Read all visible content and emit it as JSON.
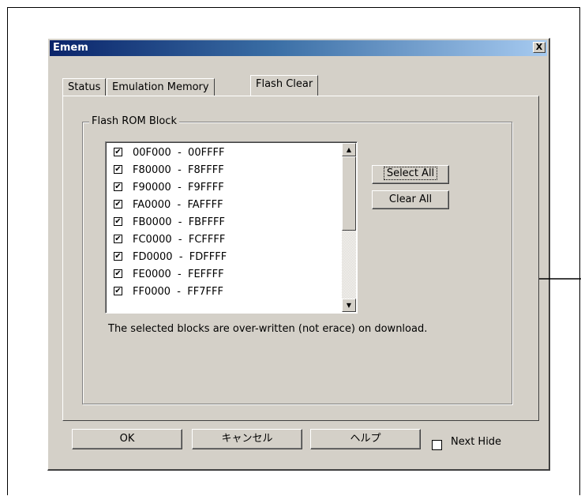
{
  "dialog": {
    "title": "Emem",
    "close_label": "X"
  },
  "tabs": [
    {
      "label": "Status"
    },
    {
      "label": "Emulation Memory"
    },
    {
      "label": "Flash Clear"
    }
  ],
  "group": {
    "label": "Flash ROM Block",
    "items": [
      {
        "range": "00F000  -  00FFFF",
        "checked": true
      },
      {
        "range": "F80000  -  F8FFFF",
        "checked": true
      },
      {
        "range": "F90000  -  F9FFFF",
        "checked": true
      },
      {
        "range": "FA0000  -  FAFFFF",
        "checked": true
      },
      {
        "range": "FB0000  -  FBFFFF",
        "checked": true
      },
      {
        "range": "FC0000  -  FCFFFF",
        "checked": true
      },
      {
        "range": "FD0000  -  FDFFFF",
        "checked": true
      },
      {
        "range": "FE0000  -  FEFFFF",
        "checked": true
      },
      {
        "range": "FF0000  -  FF7FFF",
        "checked": true
      }
    ],
    "select_all_label": "Select All",
    "clear_all_label": "Clear All",
    "note": "The selected blocks are over-written (not erace) on download."
  },
  "footer": {
    "ok_label": "OK",
    "cancel_label": "キャンセル",
    "help_label": "ヘルプ",
    "next_hide_label": "Next Hide"
  },
  "check_glyph": "✔"
}
